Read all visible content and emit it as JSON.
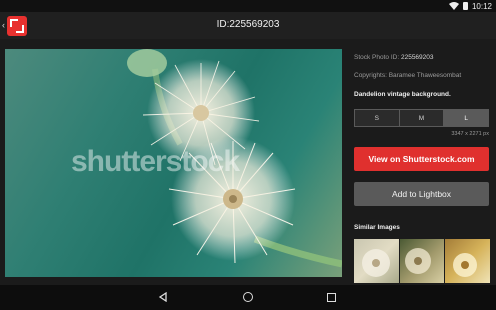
{
  "status_bar": {
    "time": "10:12",
    "icons": [
      "wifi-icon",
      "battery-icon"
    ]
  },
  "app_bar": {
    "title": "ID:225569203",
    "icons": [
      "back-chevron-icon",
      "shutterstock-logo-icon"
    ]
  },
  "photo": {
    "watermark": "shutterstock"
  },
  "details": {
    "stock_id_label": "Stock Photo ID: ",
    "stock_id_value": "225569203",
    "copyright_label": "Copyrights: ",
    "copyright_value": "Baramee Thaweesombat",
    "description": "Dandelion vintage background.",
    "sizes": [
      "S",
      "M",
      "L"
    ],
    "selected_size": "L",
    "dimensions": "3347 x 2271 px"
  },
  "buttons": {
    "view": "View on Shutterstock.com",
    "lightbox": "Add to Lightbox"
  },
  "similar": {
    "title": "Similar Images",
    "thumbnails": 3
  },
  "nav_bar": {
    "icons": [
      "back-triangle-icon",
      "home-circle-icon",
      "recents-square-icon"
    ]
  },
  "colors": {
    "accent": "#e0302e",
    "background": "#1b1b1b",
    "secondary_button": "#5a5a5a"
  }
}
